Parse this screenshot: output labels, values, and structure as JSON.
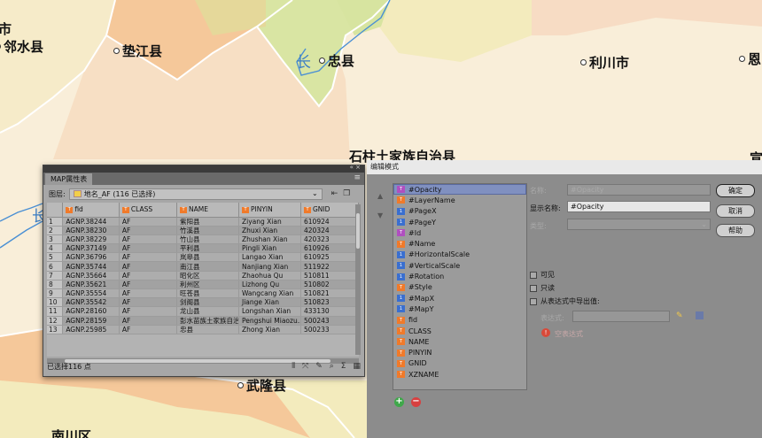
{
  "map": {
    "labels": [
      {
        "text": "市"
      },
      {
        "text": "邻水县"
      },
      {
        "text": "垫江县"
      },
      {
        "text": "忠县"
      },
      {
        "text": "利川市"
      },
      {
        "text": "恩"
      },
      {
        "text": "石柱土家族自治县"
      },
      {
        "text": "宣"
      },
      {
        "text": "武隆县"
      },
      {
        "text": "南川区"
      }
    ],
    "river_labels": [
      "长",
      "长"
    ],
    "colors": {
      "background": "#f7ecd8",
      "green": "#d8e6a6",
      "orange": "#f5c48a",
      "yellow": "#f3e8a8",
      "peach": "#f7dcc0",
      "river": "#4a8fd4"
    }
  },
  "attr_panel": {
    "tab_label": "MAP属性表",
    "top_controls": "« ×",
    "layer_label": "图层:",
    "layer_value": "地名_AF (116 已选择)",
    "columns": [
      "fid",
      "CLASS",
      "NAME",
      "PINYIN",
      "GNID"
    ],
    "rows": [
      {
        "n": "1",
        "fid": "AGNP.38244",
        "cls": "AF",
        "name": "紫阳县",
        "pinyin": "Ziyang Xian",
        "gnid": "610924"
      },
      {
        "n": "2",
        "fid": "AGNP.38230",
        "cls": "AF",
        "name": "竹溪县",
        "pinyin": "Zhuxi Xian",
        "gnid": "420324"
      },
      {
        "n": "3",
        "fid": "AGNP.38229",
        "cls": "AF",
        "name": "竹山县",
        "pinyin": "Zhushan Xian",
        "gnid": "420323"
      },
      {
        "n": "4",
        "fid": "AGNP.37149",
        "cls": "AF",
        "name": "平利县",
        "pinyin": "Pingli Xian",
        "gnid": "610926"
      },
      {
        "n": "5",
        "fid": "AGNP.36796",
        "cls": "AF",
        "name": "岚皋县",
        "pinyin": "Langao Xian",
        "gnid": "610925"
      },
      {
        "n": "6",
        "fid": "AGNP.35744",
        "cls": "AF",
        "name": "南江县",
        "pinyin": "Nanjiang Xian",
        "gnid": "511922"
      },
      {
        "n": "7",
        "fid": "AGNP.35664",
        "cls": "AF",
        "name": "昭化区",
        "pinyin": "Zhaohua Qu",
        "gnid": "510811"
      },
      {
        "n": "8",
        "fid": "AGNP.35621",
        "cls": "AF",
        "name": "利州区",
        "pinyin": "Lizhong Qu",
        "gnid": "510802"
      },
      {
        "n": "9",
        "fid": "AGNP.35554",
        "cls": "AF",
        "name": "旺苍县",
        "pinyin": "Wangcang Xian",
        "gnid": "510821"
      },
      {
        "n": "10",
        "fid": "AGNP.35542",
        "cls": "AF",
        "name": "剑阁县",
        "pinyin": "Jiange Xian",
        "gnid": "510823"
      },
      {
        "n": "11",
        "fid": "AGNP.28160",
        "cls": "AF",
        "name": "龙山县",
        "pinyin": "Longshan Xian",
        "gnid": "433130"
      },
      {
        "n": "12",
        "fid": "AGNP.28159",
        "cls": "AF",
        "name": "彭水苗族土家族自治县",
        "pinyin": "Pengshui Miaozu...",
        "gnid": "500243"
      },
      {
        "n": "13",
        "fid": "AGNP.25985",
        "cls": "AF",
        "name": "忠县",
        "pinyin": "Zhong Xian",
        "gnid": "500233"
      }
    ],
    "status": "已选择116 点"
  },
  "edit_dialog": {
    "title": "编辑模式",
    "properties": [
      {
        "label": "#Opacity",
        "icon": "p",
        "selected": true
      },
      {
        "label": "#LayerName",
        "icon": "o"
      },
      {
        "label": "#PageX",
        "icon": "b"
      },
      {
        "label": "#PageY",
        "icon": "b"
      },
      {
        "label": "#Id",
        "icon": "p"
      },
      {
        "label": "#Name",
        "icon": "o"
      },
      {
        "label": "#HorizontalScale",
        "icon": "b"
      },
      {
        "label": "#VerticalScale",
        "icon": "b"
      },
      {
        "label": "#Rotation",
        "icon": "b"
      },
      {
        "label": "#Style",
        "icon": "o"
      },
      {
        "label": "#MapX",
        "icon": "b"
      },
      {
        "label": "#MapY",
        "icon": "b"
      },
      {
        "label": "fid",
        "icon": "o"
      },
      {
        "label": "CLASS",
        "icon": "o"
      },
      {
        "label": "NAME",
        "icon": "o"
      },
      {
        "label": "PINYIN",
        "icon": "o"
      },
      {
        "label": "GNID",
        "icon": "o"
      },
      {
        "label": "XZNAME",
        "icon": "o"
      }
    ],
    "name_label": "名称:",
    "name_value": "#Opacity",
    "display_label": "显示名称:",
    "display_value": "#Opacity",
    "type_label": "类型:",
    "visible_label": "可见",
    "readonly_label": "只读",
    "expr_check_label": "从表达式中导出值:",
    "expr_label": "表达式:",
    "expr_error": "空表达式",
    "ok_label": "确定",
    "cancel_label": "取消",
    "help_label": "帮助"
  }
}
